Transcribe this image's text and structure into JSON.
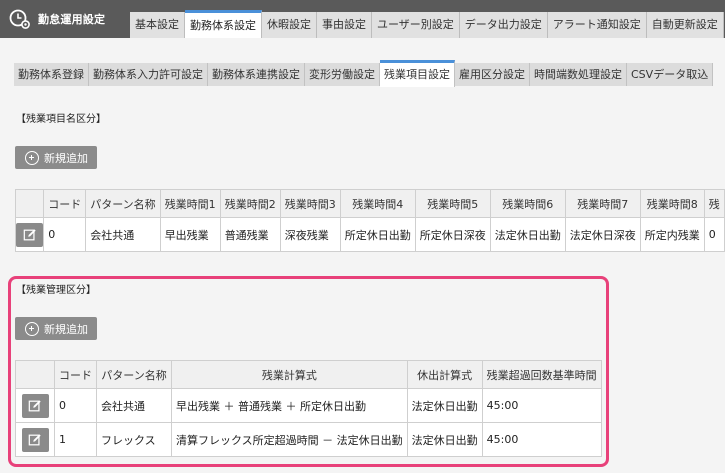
{
  "app": {
    "title": "勤怠運用設定",
    "icon": "clock-settings-icon"
  },
  "main_tabs": [
    {
      "label": "基本設定",
      "active": false
    },
    {
      "label": "勤務体系設定",
      "active": true
    },
    {
      "label": "休暇設定",
      "active": false
    },
    {
      "label": "事由設定",
      "active": false
    },
    {
      "label": "ユーザー別設定",
      "active": false
    },
    {
      "label": "データ出力設定",
      "active": false
    },
    {
      "label": "アラート通知設定",
      "active": false
    },
    {
      "label": "自動更新設定",
      "active": false
    }
  ],
  "sub_tabs": [
    {
      "label": "勤務体系登録",
      "active": false
    },
    {
      "label": "勤務体系入力許可設定",
      "active": false
    },
    {
      "label": "勤務体系連携設定",
      "active": false
    },
    {
      "label": "変形労働設定",
      "active": false
    },
    {
      "label": "残業項目設定",
      "active": true
    },
    {
      "label": "雇用区分設定",
      "active": false
    },
    {
      "label": "時間端数処理設定",
      "active": false
    },
    {
      "label": "CSVデータ取込",
      "active": false
    }
  ],
  "section1": {
    "title": "【残業項目名区分】",
    "add_label": "新規追加",
    "headers": [
      "コード",
      "パターン名称",
      "残業時間1",
      "残業時間2",
      "残業時間3",
      "残業時間4",
      "残業時間5",
      "残業時間6",
      "残業時間7",
      "残業時間8",
      "残"
    ],
    "rows": [
      [
        "0",
        "会社共通",
        "早出残業",
        "普通残業",
        "深夜残業",
        "所定休日出勤",
        "所定休日深夜",
        "法定休日出勤",
        "法定休日深夜",
        "所定内残業",
        "0"
      ]
    ]
  },
  "section2": {
    "title": "【残業管理区分】",
    "add_label": "新規追加",
    "headers": [
      "コード",
      "パターン名称",
      "残業計算式",
      "休出計算式",
      "残業超過回数基準時間"
    ],
    "rows": [
      [
        "0",
        "会社共通",
        "早出残業 ＋ 普通残業 ＋ 所定休日出勤",
        "法定休日出勤",
        "45:00"
      ],
      [
        "1",
        "フレックス",
        "清算フレックス所定超過時間 － 法定休日出勤",
        "法定休日出勤",
        "45:00"
      ]
    ]
  },
  "colors": {
    "accent": "#4a90d9",
    "highlight": "#e8417a",
    "topbar": "#5a5a5a",
    "button": "#8b8b8b"
  }
}
